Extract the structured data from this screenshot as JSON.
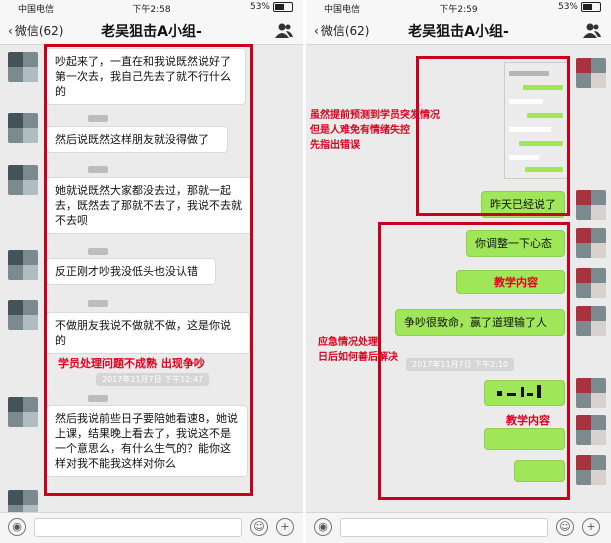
{
  "status_left": {
    "carrier": "中国电信",
    "time": "下午2:58",
    "battery": "53%"
  },
  "status_right": {
    "carrier": "中国电信",
    "time": "下午2:59",
    "battery": "53%"
  },
  "nav_left": {
    "back": "微信(62)",
    "title": "老吴狙击A小组-"
  },
  "nav_right": {
    "back": "微信(62)",
    "title": "老吴狙击A小组-"
  },
  "left_messages": [
    "吵起来了，一直在和我说既然说好了第一次去，我自己先去了就不行什么的",
    "然后说既然这样朋友就没得做了",
    "她就说既然大家都没去过，那就一起去，既然去了那就不去了，我说不去就不去呗",
    "反正刚才吵我没低头也没认错",
    "不做朋友我说不做就不做，这是你说的",
    "然后我说前些日子要陪她看速8，她说上课，结果晚上看去了，我说这不是一个意思么，有什么生气的？能你这样对我不能我这样对你么"
  ],
  "left_timestamp": "2017年11月7日 下午12:47",
  "left_annotation": "学员处理问题不成熟 出现争吵",
  "right_messages": [
    "昨天已经说了",
    "你调整一下心态",
    "争吵很致命，赢了道理输了人"
  ],
  "right_timestamp": "2017年11月7日 下午2:10",
  "right_annotation_top": [
    "虽然提前预测到学员突发情况",
    "但是人难免有情绪失控",
    "先指出错误"
  ],
  "right_annotation_mid": [
    "应急情况处理",
    "日后如何善后解决"
  ],
  "overlay_label_1": "教学内容",
  "overlay_label_2": "教学内容",
  "input_icons": {
    "voice": "voice-icon",
    "emoji": "emoji-icon",
    "plus": "plus-icon"
  },
  "colors": {
    "annotation_red": "#c8001e",
    "bubble_green": "#9fe658"
  }
}
